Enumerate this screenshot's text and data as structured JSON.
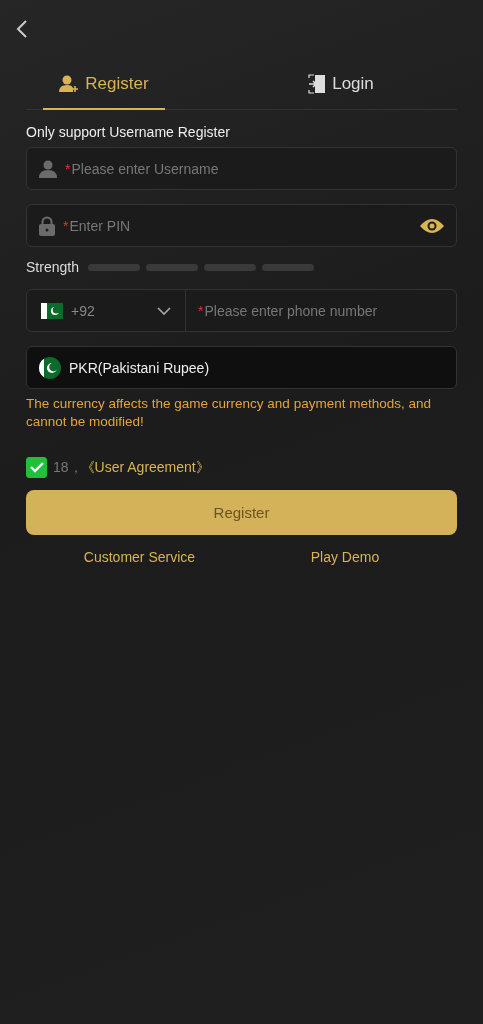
{
  "tabs": [
    {
      "label": "Register",
      "selected": true
    },
    {
      "label": "Login",
      "selected": false
    }
  ],
  "notice": "Only support Username Register",
  "username": {
    "required_mark": "*",
    "placeholder": "Please enter Username"
  },
  "pin": {
    "required_mark": "*",
    "placeholder": "Enter PIN"
  },
  "strength": {
    "label": "Strength",
    "bars": [
      {
        "on": false
      },
      {
        "on": false
      },
      {
        "on": false
      },
      {
        "on": false
      }
    ]
  },
  "phone": {
    "code": "+92",
    "required_mark": "*",
    "placeholder": "Please enter phone number"
  },
  "currency": {
    "label": "PKR(Pakistani Rupee)"
  },
  "warning": "The currency affects the game currency and payment methods, and cannot be modified!",
  "agreement": {
    "checked": true,
    "prefix": "18，",
    "link": "《User Agreement》"
  },
  "submit": "Register",
  "links": [
    "Customer Service",
    "Play Demo"
  ]
}
